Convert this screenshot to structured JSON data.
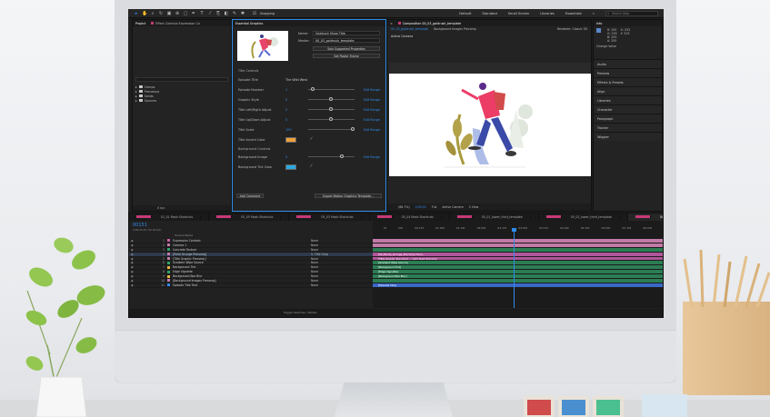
{
  "toolbar": {
    "snapping_label": "Snapping",
    "workspaces": [
      "Default",
      "Standard",
      "Small Screen",
      "Libraries",
      "Essentials"
    ],
    "search_placeholder": "Search Help"
  },
  "project_panel": {
    "tabs": [
      "Project",
      "Effect Controls Expression Co"
    ],
    "folders": [
      "Comps",
      "Precomps",
      "Solids",
      "Sources"
    ],
    "footer": "8 bpc"
  },
  "essential_graphics": {
    "tab": "Essential Graphics",
    "name_label": "Name:",
    "name_value": "Goldrush Show Title",
    "master_label": "Master:",
    "master_value": "00_03_goldrush_template",
    "solo_button": "Solo Supported Properties",
    "poster_button": "Set Poster Frame",
    "section_title_controls": "Title Controls",
    "episode_title_label": "Episode Title",
    "episode_title_value": "The Wild West",
    "rows": [
      {
        "label": "Episode Number",
        "value": "1",
        "knob": 0.05
      },
      {
        "label": "Graphic Style",
        "value": "0",
        "knob": 0.45
      },
      {
        "label": "Title Left/Right Adjust",
        "value": "0",
        "knob": 0.45
      },
      {
        "label": "Title Up/Down Adjust",
        "value": "0",
        "knob": 0.45
      },
      {
        "label": "Title Scale",
        "value": "100",
        "knob": 0.92
      }
    ],
    "edit_range": "Edit Range",
    "accent_label": "Title Accent Color",
    "accent_color": "#f0a13c",
    "section_background_controls": "Background Controls",
    "bg_image_label": "Background Image",
    "bg_image_value": "0",
    "bg_tint_label": "Background Tint Color",
    "bg_tint_color": "#2ba9e0",
    "add_comment": "Add Comment",
    "export_button": "Export Motion Graphics Template..."
  },
  "composition": {
    "tab": "Composition 00_03_goldrush_template",
    "subtabs": [
      "00_03_goldrush_template",
      "Background Images Precomp"
    ],
    "renderer": "Renderer:   Classic 3D",
    "active_camera": "Active Camera",
    "bar": [
      "(66.7%)",
      "0;00;01",
      "Full",
      "Active Camera",
      "2 View"
    ]
  },
  "side_panel": {
    "info_tab": "Info",
    "info_lines": [
      "R: 255",
      "G: 255",
      "B: 255",
      "A: 255"
    ],
    "xy": [
      "X: 253",
      "Y: 319"
    ],
    "change_value": "Change Value",
    "items": [
      "Audio",
      "Preview",
      "Effects & Presets",
      "Align",
      "Libraries",
      "Character",
      "Paragraph",
      "Tracker",
      "Wiggler"
    ]
  },
  "timeline": {
    "tabs": [
      "01_01 Mask Shortcuts",
      "05_05 Mask Shortcuts",
      "05_03 Mask Shortcuts",
      "05_04 Mask Shortcuts",
      "05_01_lower_third_template",
      "05_02_lower_third_template",
      "00_03_goldrush_template",
      "00_04_goldrush_map_template"
    ],
    "active_tab": 6,
    "timecode": "00151",
    "timecode_sub": "0;00;05;01 (30.00 fps)",
    "header": "Source Name",
    "ruler": [
      "0f",
      "00f",
      "00:15f",
      "01:00f",
      "01:15f",
      "02:00f",
      "02:15f",
      "03:00f",
      "03:15f",
      "04:00f",
      "04:15f",
      "05:00f",
      "05:15f",
      "06:00f"
    ],
    "footer": "Toggle Switches / Modes",
    "layers": [
      {
        "n": "1",
        "name": "Expression Controls",
        "color": "#c75fa4",
        "mode": "None",
        "bar": "#c27aa7",
        "label": ""
      },
      {
        "n": "2",
        "name": "Camera 1",
        "color": "#c27aa7",
        "mode": "None",
        "bar": "#c27aa7",
        "label": ""
      },
      {
        "n": "3",
        "name": "Concrete Texture",
        "color": "#2fa66a",
        "mode": "None",
        "bar": "#2c7d54",
        "label": ""
      },
      {
        "n": "4",
        "name": "[Point Grunge Precomp]",
        "color": "#c27aa7",
        "mode": "5. Title Grup",
        "bar": "#b0569a",
        "label": "[00_Pointy_Grunge_Precomp] Hum..."
      },
      {
        "n": "5",
        "name": "[Title Graphic Precomp]",
        "color": "#c27aa7",
        "mode": "None",
        "bar": "#b0569a",
        "label": "[Title Graphic Precomp] — Gold Rush Precomp"
      },
      {
        "n": "6",
        "name": "Gradient Wipe Source",
        "color": "#2fa66a",
        "mode": "None",
        "bar": "#2c7d54",
        "label": "[Gradient Wipe Source]"
      },
      {
        "n": "7",
        "name": "Background Tint",
        "color": "#e8b63a",
        "mode": "None",
        "bar": "#2c7d54",
        "label": "[Background Tint]"
      },
      {
        "n": "8",
        "name": "Edge Vignette",
        "color": "#2fa66a",
        "mode": "None",
        "bar": "#2c7d54",
        "label": "[Edge Vignette]"
      },
      {
        "n": "9",
        "name": "Background Box Blur",
        "color": "#e8b63a",
        "mode": "None",
        "bar": "#2c7d54",
        "label": "[Background Box Blur]"
      },
      {
        "n": "10",
        "name": "[Background Images Precomp]",
        "color": "#c27aa7",
        "mode": "None",
        "bar": "#2c7d54",
        "label": ""
      },
      {
        "n": "11",
        "name": "Episode Title Text",
        "color": "#2d8ceb",
        "mode": "None",
        "bar": "#3a68c8",
        "label": "[Episode Title]"
      }
    ]
  }
}
